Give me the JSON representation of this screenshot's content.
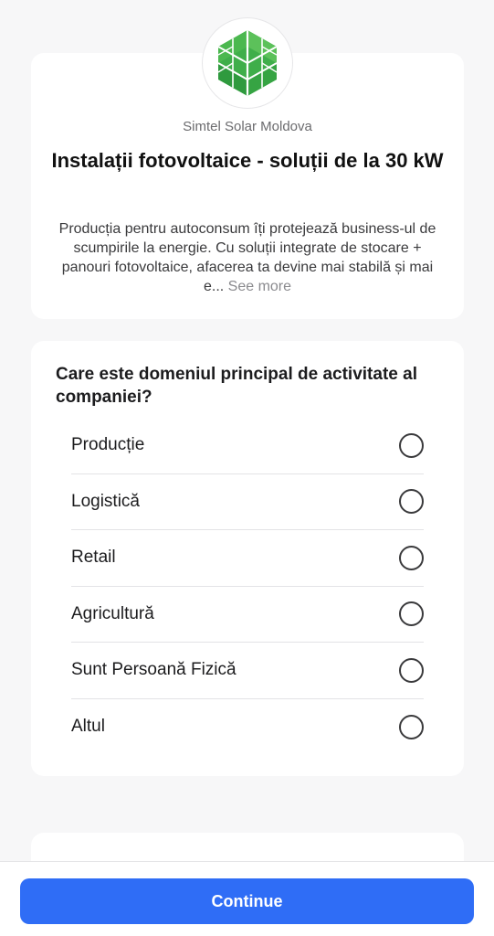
{
  "header": {
    "brand_name": "Simtel Solar Moldova",
    "logo_icon": "green-leaf-hexagon-logo",
    "title": "Instalații fotovoltaice - soluții de la 30 kW",
    "description": "Producția pentru autoconsum îți protejează business-ul de scumpirile la energie. Cu soluții integrate de stocare + panouri fotovoltaice, afacerea ta devine mai stabilă și mai e...",
    "see_more": "See more"
  },
  "question": {
    "text": "Care este domeniul principal de activitate al companiei?",
    "options": [
      {
        "label": "Producție"
      },
      {
        "label": "Logistică"
      },
      {
        "label": "Retail"
      },
      {
        "label": "Agricultură"
      },
      {
        "label": "Sunt Persoană Fizică"
      },
      {
        "label": "Altul"
      }
    ]
  },
  "footer": {
    "continue_label": "Continue"
  },
  "colors": {
    "accent": "#2f6df6",
    "logo_green": "#4caf50"
  }
}
